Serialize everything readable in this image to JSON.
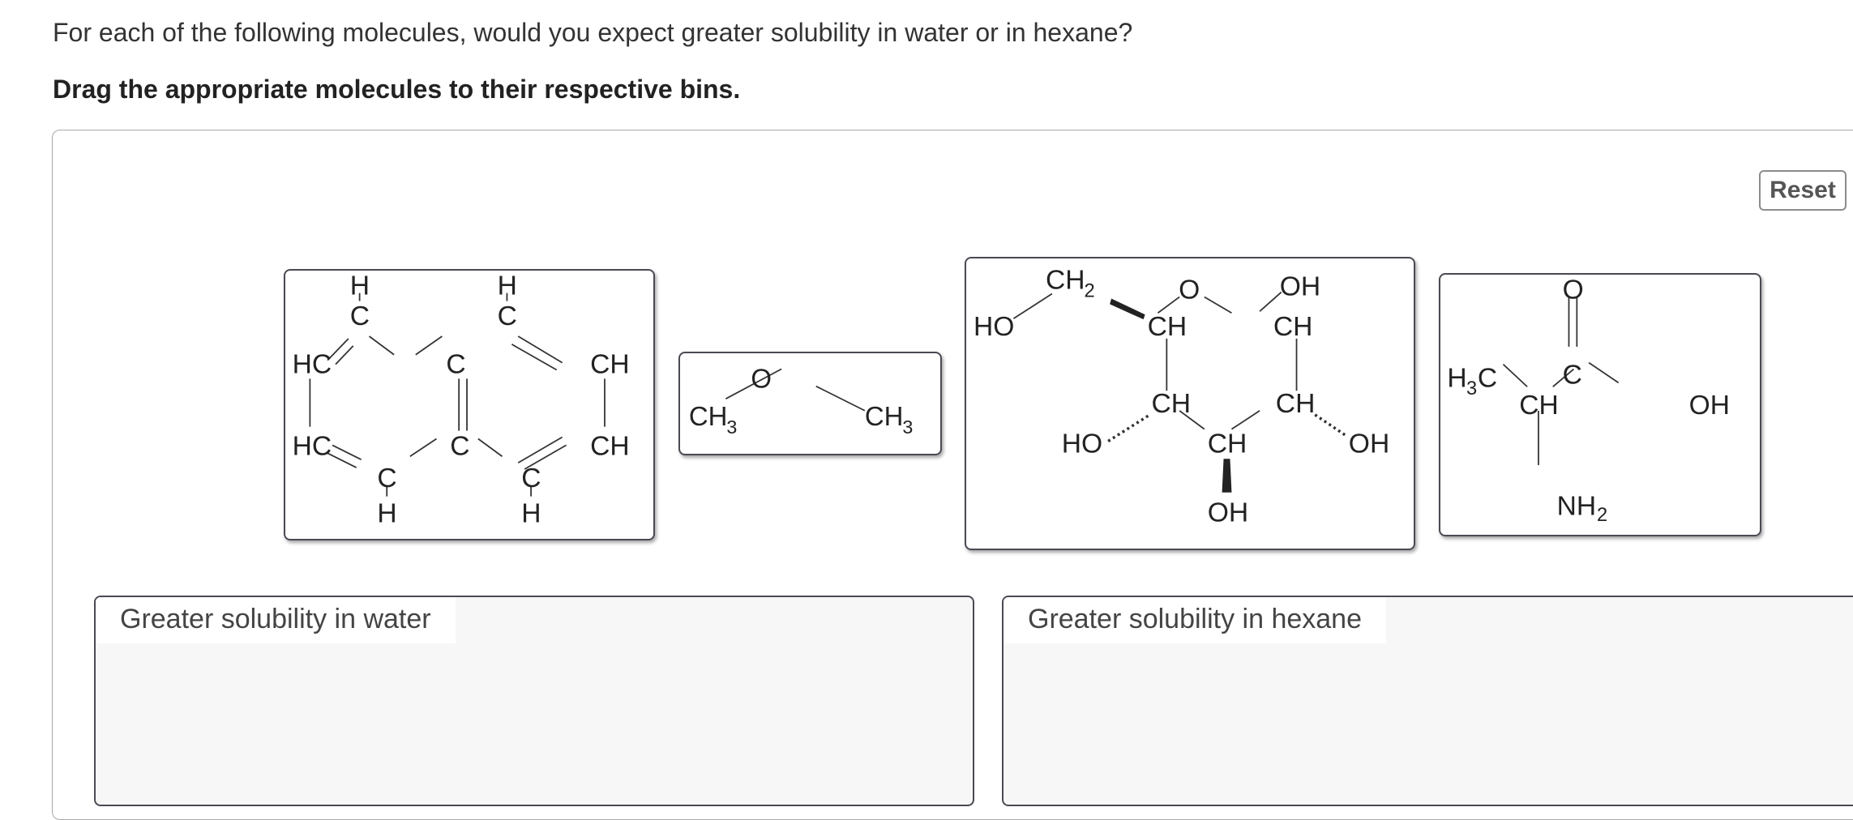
{
  "question": {
    "prompt": "For each of the following molecules, would you expect greater solubility in water or in hexane?",
    "instruction": "Drag the appropriate molecules to their respective bins."
  },
  "controls": {
    "reset_label": "Reset"
  },
  "molecules": {
    "naphthalene": {
      "H": "H",
      "C": "C",
      "HC": "HC",
      "CH": "CH"
    },
    "dimethyl_ether": {
      "O": "O",
      "CH": "CH",
      "three": "3"
    },
    "glucose": {
      "CH": "CH",
      "two": "2",
      "O": "O",
      "OH": "OH",
      "HO": "HO"
    },
    "alanine": {
      "H": "H",
      "three": "3",
      "C": "C",
      "CH": "CH",
      "O": "O",
      "OH": "OH",
      "NH": "NH",
      "two": "2"
    }
  },
  "bins": [
    {
      "label": "Greater solubility in water"
    },
    {
      "label": "Greater solubility in hexane"
    }
  ]
}
